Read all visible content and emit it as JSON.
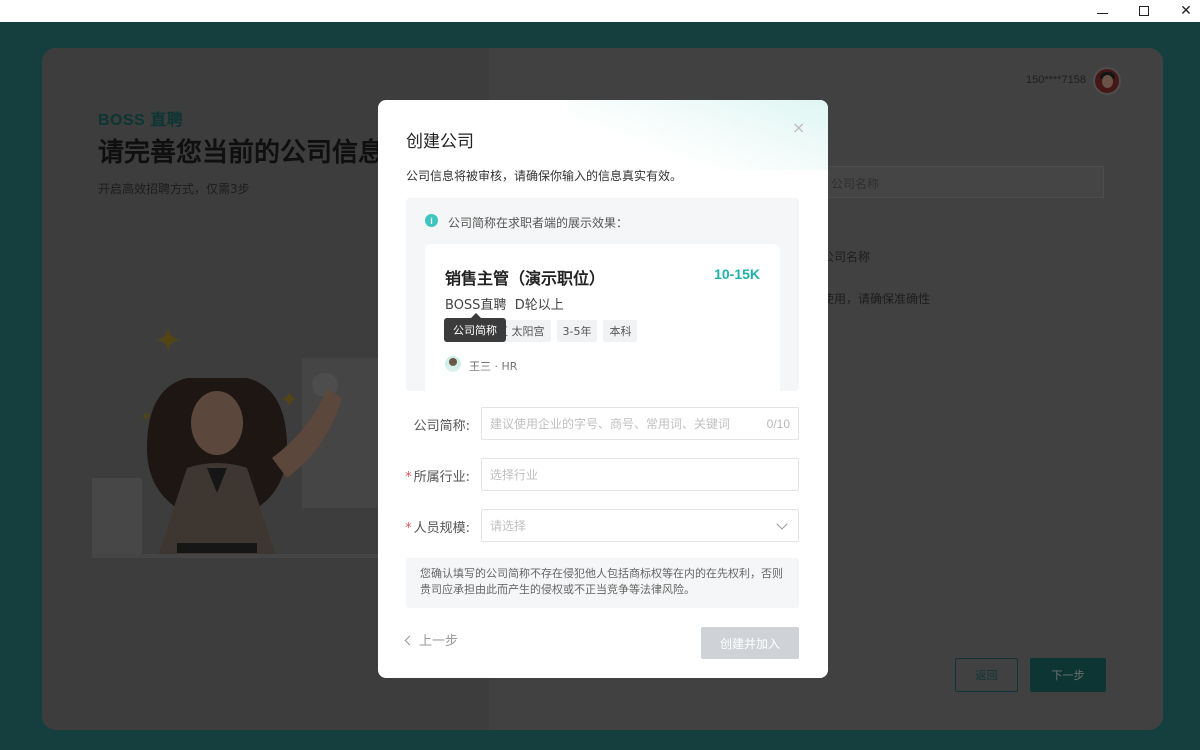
{
  "window": {
    "minimize_icon": "minimize-icon",
    "maximize_icon": "maximize-icon",
    "close_icon": "close-icon",
    "close_glyph": "✕"
  },
  "background": {
    "brand": "BOSS 直聘",
    "title": "请完善您当前的公司信息",
    "subtitle": "开启高效招聘方式，仅需3步",
    "user_phone": "150****7158",
    "company_name_placeholder": "公司名称",
    "company_name_hint": "公司名称",
    "usage_hint": "使用，请确保准确性",
    "back_label": "返回",
    "next_label": "下一步",
    "sparkle_glyph": "✦"
  },
  "modal": {
    "title": "创建公司",
    "close_glyph": "×",
    "description": "公司信息将被审核，请确保你输入的信息真实有效。",
    "preview_hint": "公司简称在求职者端的展示效果：",
    "info_glyph": "i",
    "job": {
      "title": "销售主管（演示职位）",
      "salary": "10-15K",
      "company": "BOSS直聘",
      "stage": "D轮以上",
      "tags": [
        "区 太阳宫",
        "3-5年",
        "本科"
      ],
      "tooltip": "公司简称",
      "hr_name": "王三 · HR"
    },
    "form": {
      "short_name_label": "公司简称:",
      "short_name_placeholder": "建议使用企业的字号、商号、常用词、关键词",
      "short_name_counter": "0/10",
      "industry_label": "所属行业:",
      "industry_placeholder": "选择行业",
      "size_label": "人员规模:",
      "size_placeholder": "请选择",
      "required_mark": "*"
    },
    "notice": "您确认填写的公司简称不存在侵犯他人包括商标权等在内的在先权利，否则贵司应承担由此而产生的侵权或不正当竞争等法律风险。",
    "prev_label": "上一步",
    "submit_label": "创建并加入"
  },
  "colors": {
    "accent": "#1fb3a8",
    "brand_teal": "#2b7f7c",
    "required": "#e05656"
  }
}
